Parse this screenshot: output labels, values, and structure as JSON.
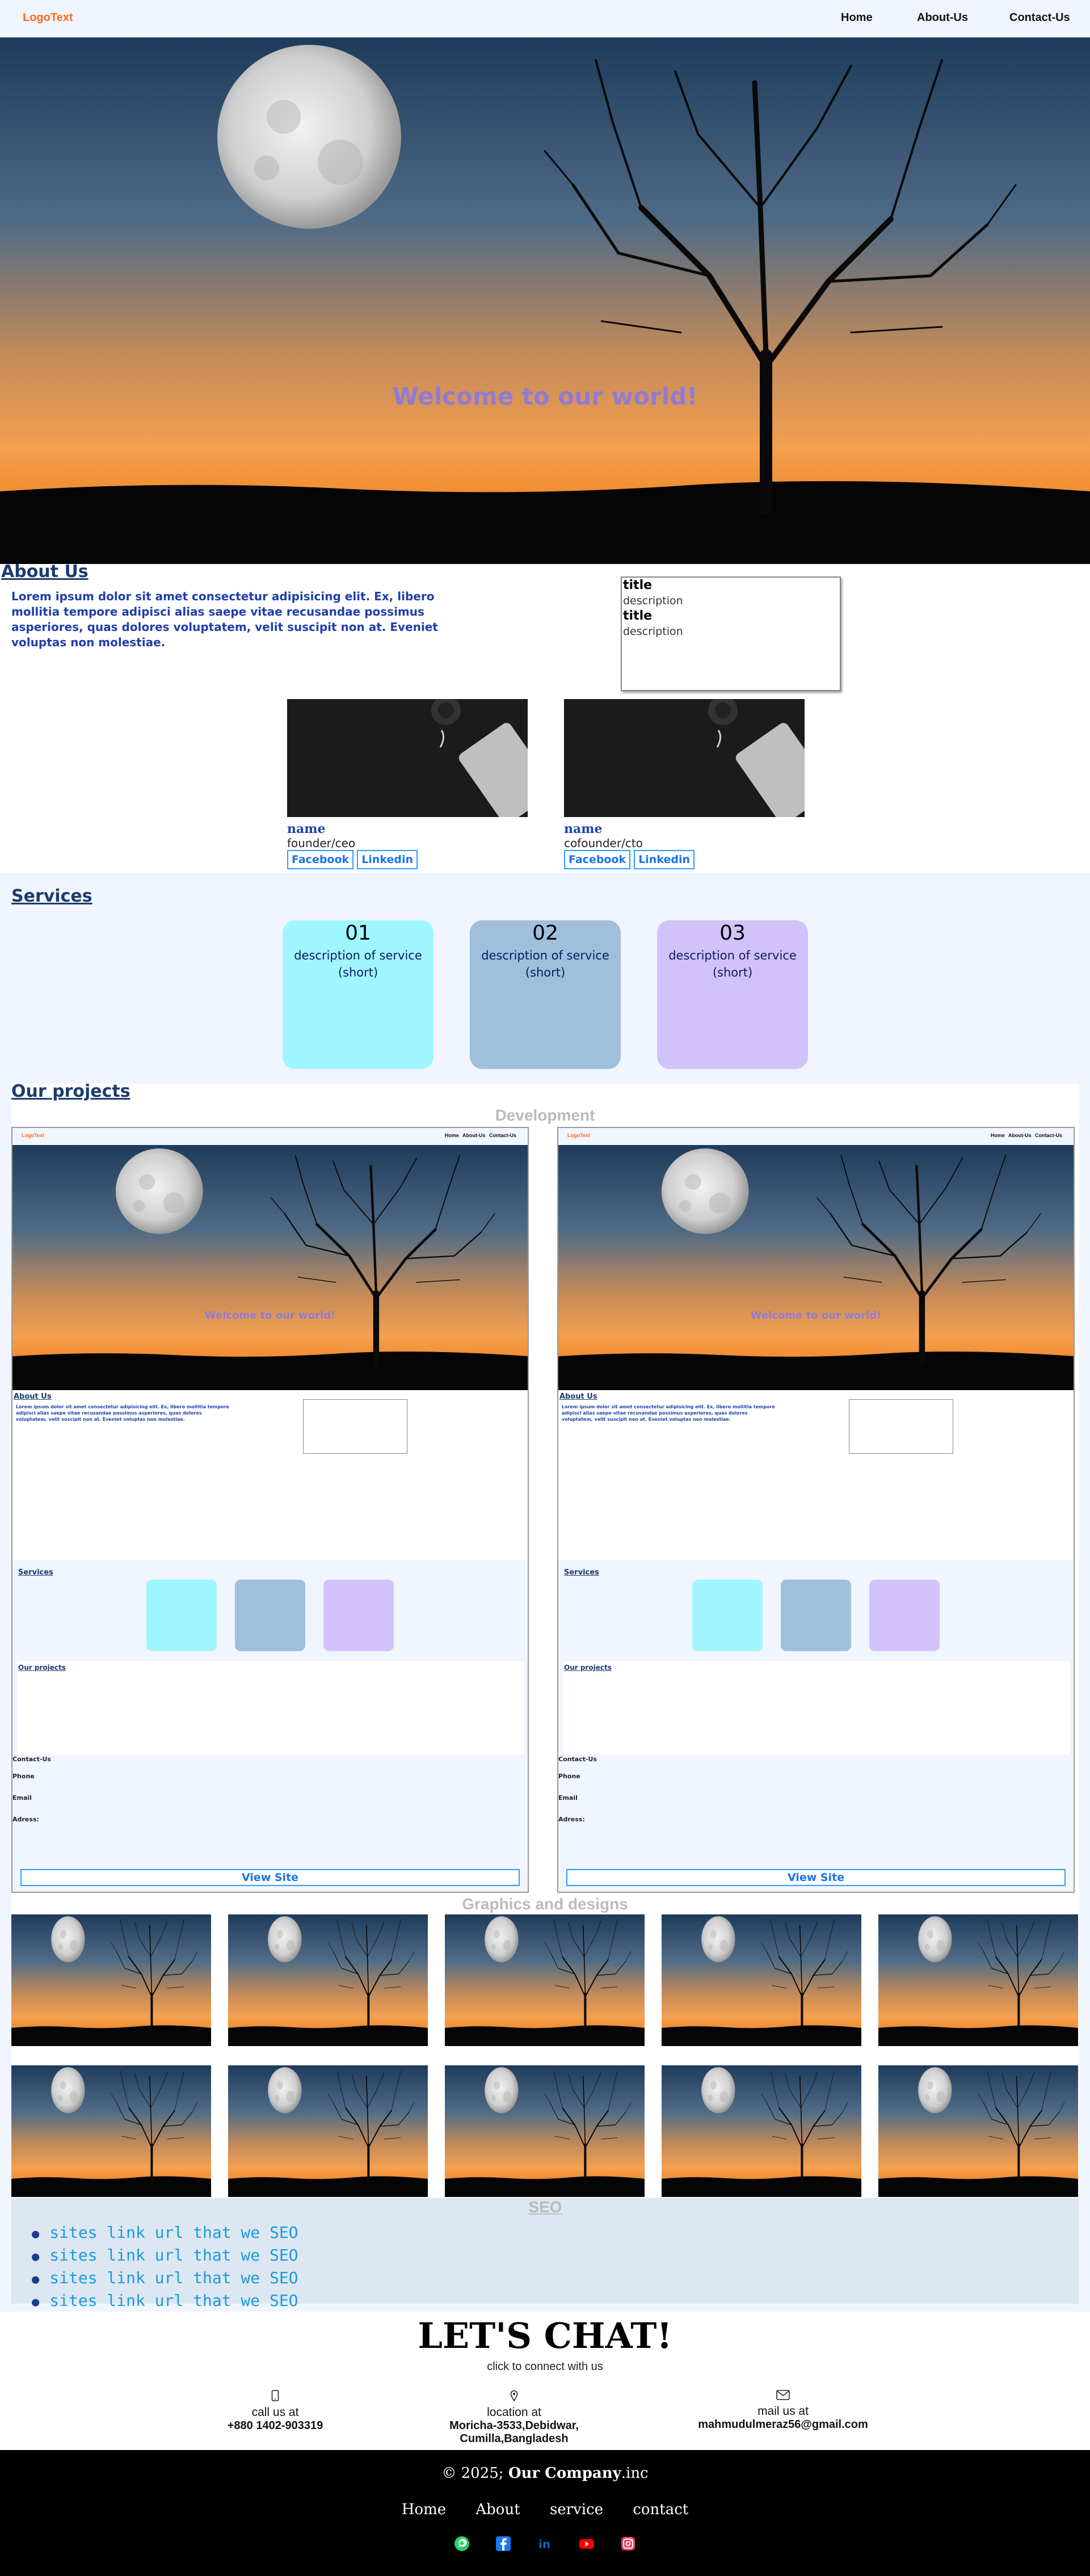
{
  "nav": {
    "logo": "LogoText",
    "links": [
      "Home",
      "About-Us",
      "Contact-Us"
    ]
  },
  "hero": {
    "title": "Welcome to our world!"
  },
  "about": {
    "heading": "About Us",
    "text": "Lorem ipsum dolor sit amet consectetur adipisicing elit. Ex, libero mollitia tempore adipisci alias saepe vitae recusandae possimus asperiores, quas dolores voluptatem, velit suscipit non at. Eveniet voluptas non molestiae.",
    "box": [
      {
        "title": "title",
        "description": "description"
      },
      {
        "title": "title",
        "description": "description"
      }
    ]
  },
  "team": [
    {
      "name": "name",
      "role": "founder/ceo",
      "links": [
        "Facebook",
        "Linkedin"
      ]
    },
    {
      "name": "name",
      "role": "cofounder/cto",
      "links": [
        "Facebook",
        "Linkedin"
      ]
    }
  ],
  "services": {
    "heading": "Services",
    "items": [
      {
        "num": "01",
        "desc": "description of service (short)",
        "color": "#a0f6ff"
      },
      {
        "num": "02",
        "desc": "description of service (short)",
        "color": "#9fbfdb"
      },
      {
        "num": "03",
        "desc": "description of service (short)",
        "color": "#d2c2fb"
      }
    ]
  },
  "projects": {
    "heading": "Our projects",
    "development": "Development",
    "view_site": "View Site",
    "mini": {
      "logo": "LogoText",
      "links": "Home About-Us Contact-Us",
      "hero_title": "Welcome to our world!",
      "about": "About Us",
      "services": "Services",
      "projects": "Our projects",
      "contact": "Contact-Us",
      "phone": "Phone",
      "email": "Email",
      "address": "Adress:"
    },
    "graphics": "Graphics and designs"
  },
  "seo": {
    "heading": "SEO",
    "links": [
      "sites link url that we SEO",
      "sites link url that we SEO",
      "sites link url that we SEO",
      "sites link url that we SEO"
    ]
  },
  "chat": {
    "title": "LET'S CHAT!",
    "subtitle": "click to connect with us",
    "contacts": [
      {
        "label": "call us at",
        "value": "+880 1402-903319",
        "icon": "phone-icon"
      },
      {
        "label": "location at",
        "value": "Moricha-3533,Debidwar, Cumilla,Bangladesh",
        "icon": "location-icon"
      },
      {
        "label": "mail us at",
        "value": "mahmudulmeraz56@gmail.com",
        "icon": "mail-icon"
      }
    ]
  },
  "footer": {
    "copyright": "© 2025;",
    "company": "Our Company",
    "suffix": ".inc",
    "links": [
      "Home",
      "About",
      "service",
      "contact"
    ]
  },
  "colors": {
    "accent": "#1a73e8",
    "logo": "#ff6a1a",
    "heading": "#1b3d6d"
  }
}
